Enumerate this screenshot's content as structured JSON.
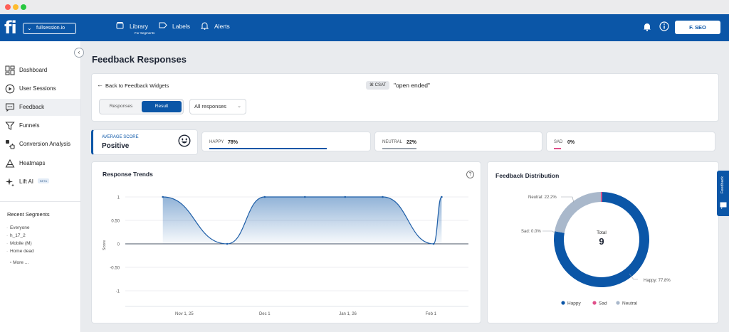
{
  "topnav": {
    "logo": "fi",
    "site": "fullsession.io",
    "links": [
      {
        "label": "Library",
        "sub": "For Segments"
      },
      {
        "label": "Labels"
      },
      {
        "label": "Alerts"
      }
    ],
    "user": "F. SEO"
  },
  "sidebar": {
    "items": [
      {
        "label": "Dashboard",
        "icon": "dashboard-icon"
      },
      {
        "label": "User Sessions",
        "icon": "play-circle-icon"
      },
      {
        "label": "Feedback",
        "icon": "chat-icon"
      },
      {
        "label": "Funnels",
        "icon": "funnel-icon"
      },
      {
        "label": "Conversion Analysis",
        "icon": "conversion-icon"
      },
      {
        "label": "Heatmaps",
        "icon": "heatmap-icon"
      },
      {
        "label": "Lift AI",
        "icon": "sparkle-icon",
        "badge": "BETA"
      }
    ],
    "recent_title": "Recent Segments",
    "segments": [
      "Everyone",
      "h_17_2",
      "Mobile (M)",
      "Home dead"
    ],
    "more": "More ..."
  },
  "page": {
    "title": "Feedback Responses",
    "back": "Back to Feedback Widgets",
    "badge": "CSAT",
    "widget_name": "\"open ended\"",
    "toggle": {
      "responses": "Responses",
      "result": "Result"
    },
    "filter": "All responses"
  },
  "stats": {
    "average_label": "AVERAGE SCORE",
    "average_value": "Positive",
    "happy": {
      "label": "HAPPY",
      "value": "78%",
      "fraction": 0.78,
      "color": "#0b56a7"
    },
    "neutral": {
      "label": "NEUTRAL",
      "value": "22%",
      "fraction": 0.22,
      "color": "#9aa3ad"
    },
    "sad": {
      "label": "SAD",
      "value": "0%",
      "fraction": 0.0,
      "color": "#e0508a"
    }
  },
  "trends": {
    "title": "Response Trends",
    "ylabel": "Score",
    "yticks": [
      "1",
      "0.50",
      "0",
      "-0.50",
      "-1"
    ],
    "xticks": [
      "Nov 1, 25",
      "Dec 1",
      "Jan 1, 26",
      "Feb 1"
    ]
  },
  "chart_data": [
    {
      "type": "line",
      "title": "Response Trends",
      "ylabel": "Score",
      "ylim": [
        -1,
        1
      ],
      "x_ticks": [
        "Nov 1, 25",
        "Dec 1",
        "Jan 1, 26",
        "Feb 1"
      ],
      "series": [
        {
          "values": [
            {
              "x": "2025-10-24",
              "y": 1
            },
            {
              "x": "2025-11-17",
              "y": 0
            },
            {
              "x": "2025-12-01",
              "y": 1
            },
            {
              "x": "2025-12-16",
              "y": 1
            },
            {
              "x": "2025-12-31",
              "y": 1
            },
            {
              "x": "2026-01-14",
              "y": 1
            },
            {
              "x": "2026-02-02",
              "y": 0
            },
            {
              "x": "2026-02-05",
              "y": 1
            }
          ]
        }
      ],
      "grid": true
    },
    {
      "type": "pie",
      "title": "Feedback Distribution",
      "center_label": "Total",
      "total": "9",
      "slices": [
        {
          "name": "Happy",
          "value": 77.8,
          "label": "Happy: 77.8%",
          "color": "#0b56a7"
        },
        {
          "name": "Sad",
          "value": 0.0,
          "label": "Sad: 0.0%",
          "color": "#e0508a"
        },
        {
          "name": "Neutral",
          "value": 22.2,
          "label": "Neutral: 22.2%",
          "color": "#a9b8cb"
        }
      ],
      "legend": "bottom"
    }
  ],
  "side_tab": "Feedback"
}
